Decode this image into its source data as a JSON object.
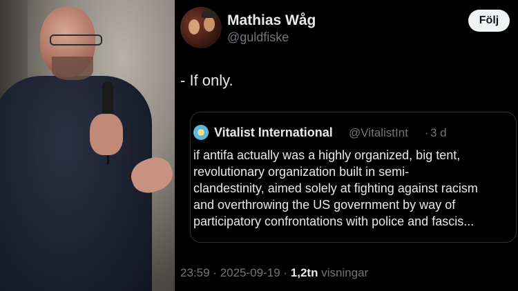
{
  "author": {
    "name": "Mathias Wåg",
    "handle": "@guldfiske",
    "follow_label": "Följ"
  },
  "tweet": {
    "text": "- If only."
  },
  "quoted_tweet": {
    "name": "Vitalist International",
    "handle": "@VitalistInt",
    "separator": "·",
    "time": "3 d",
    "lines": [
      "if antifa actually was a highly organized, big tent,",
      "revolutionary organization built in semi-",
      "clandestinity, aimed solely at fighting against racism",
      "and overthrowing the US government by way of",
      "participatory confrontations with police and fascis..."
    ]
  },
  "meta": {
    "time": "23:59",
    "sep1": "·",
    "date": "2025-09-19",
    "sep2": "·",
    "views_count": "1,2tn",
    "views_label": "visningar"
  }
}
